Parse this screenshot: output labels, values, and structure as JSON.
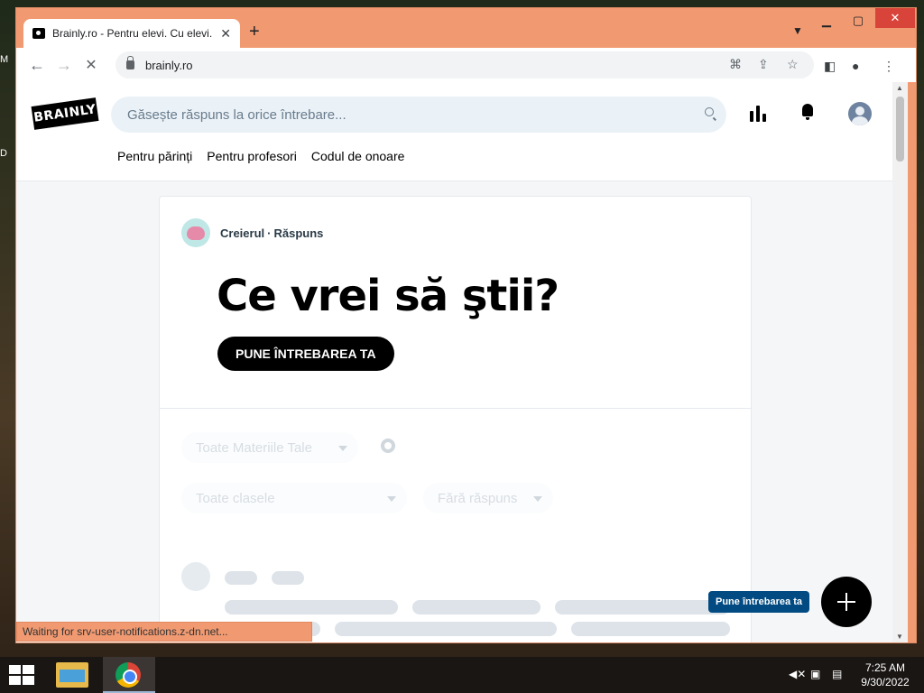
{
  "desktop": {
    "left_frag_1": "M",
    "left_frag_2": "D"
  },
  "browser": {
    "tab_title": "Brainly.ro - Pentru elevi. Cu elevi.",
    "new_tab": "+",
    "url": "brainly.ro",
    "status_text": "Waiting for srv-user-notifications.z-dn.net..."
  },
  "site": {
    "logo": "BRAINLY",
    "search_placeholder": "Găsește răspuns la orice întrebare...",
    "nav": [
      "Pentru părinți",
      "Pentru profesori",
      "Codul de onoare"
    ]
  },
  "card": {
    "author": "Creierul",
    "separator": "·",
    "tag": "Răspuns",
    "headline": "Ce vrei să ştii?",
    "ask_button": "PUNE ÎNTREBAREA TA"
  },
  "filters": {
    "subjects": "Toate Materiile Tale",
    "classes": "Toate clasele",
    "status": "Fără răspuns"
  },
  "fab": {
    "tooltip": "Pune întrebarea ta"
  },
  "taskbar": {
    "time": "7:25 AM",
    "date": "9/30/2022"
  },
  "icons": {
    "back": "arrow-left-icon",
    "forward": "arrow-right-icon",
    "stop": "close-icon",
    "translate": "translate-icon",
    "share": "share-icon",
    "bookmark": "star-icon",
    "sidebar": "side-panel-icon",
    "profile": "profile-icon",
    "menu": "kebab-menu-icon"
  },
  "colors": {
    "window_frame": "#f19a72",
    "search_bg": "#ebf2f7",
    "tooltip_bg": "#014a82",
    "primary_button": "#000000"
  }
}
